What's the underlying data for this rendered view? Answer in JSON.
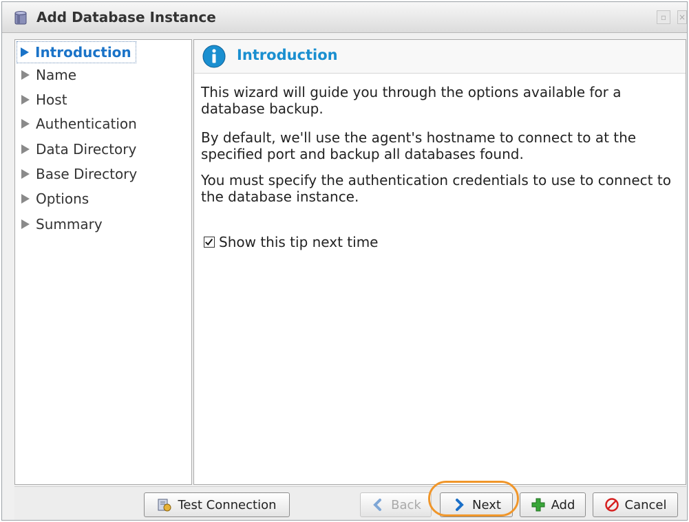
{
  "window": {
    "title": "Add Database Instance"
  },
  "sidebar": {
    "items": [
      {
        "label": "Introduction",
        "active": true
      },
      {
        "label": "Name",
        "active": false
      },
      {
        "label": "Host",
        "active": false
      },
      {
        "label": "Authentication",
        "active": false
      },
      {
        "label": "Data Directory",
        "active": false
      },
      {
        "label": "Base Directory",
        "active": false
      },
      {
        "label": "Options",
        "active": false
      },
      {
        "label": "Summary",
        "active": false
      }
    ]
  },
  "content": {
    "title": "Introduction",
    "paragraphs": [
      "This wizard will guide you through the options available for a database backup.",
      "By default, we'll use the agent's hostname to connect to at the specified port and backup all databases found.",
      "You must specify the authentication credentials to use to connect to the database instance."
    ],
    "tip_label": "Show this tip next time",
    "tip_checked": true
  },
  "footer": {
    "test_connection_label": "Test Connection",
    "back_label": "Back",
    "next_label": "Next",
    "add_label": "Add",
    "cancel_label": "Cancel"
  },
  "colors": {
    "accent": "#1a8fd0",
    "highlight": "#f0962a",
    "add_green": "#3aa63a",
    "cancel_red": "#d62020"
  },
  "icons": {
    "title": "database-icon",
    "content": "info-icon",
    "test_connection": "test-connection-icon",
    "back": "chevron-left-icon",
    "next": "chevron-right-icon",
    "add": "plus-icon",
    "cancel": "cancel-icon"
  }
}
